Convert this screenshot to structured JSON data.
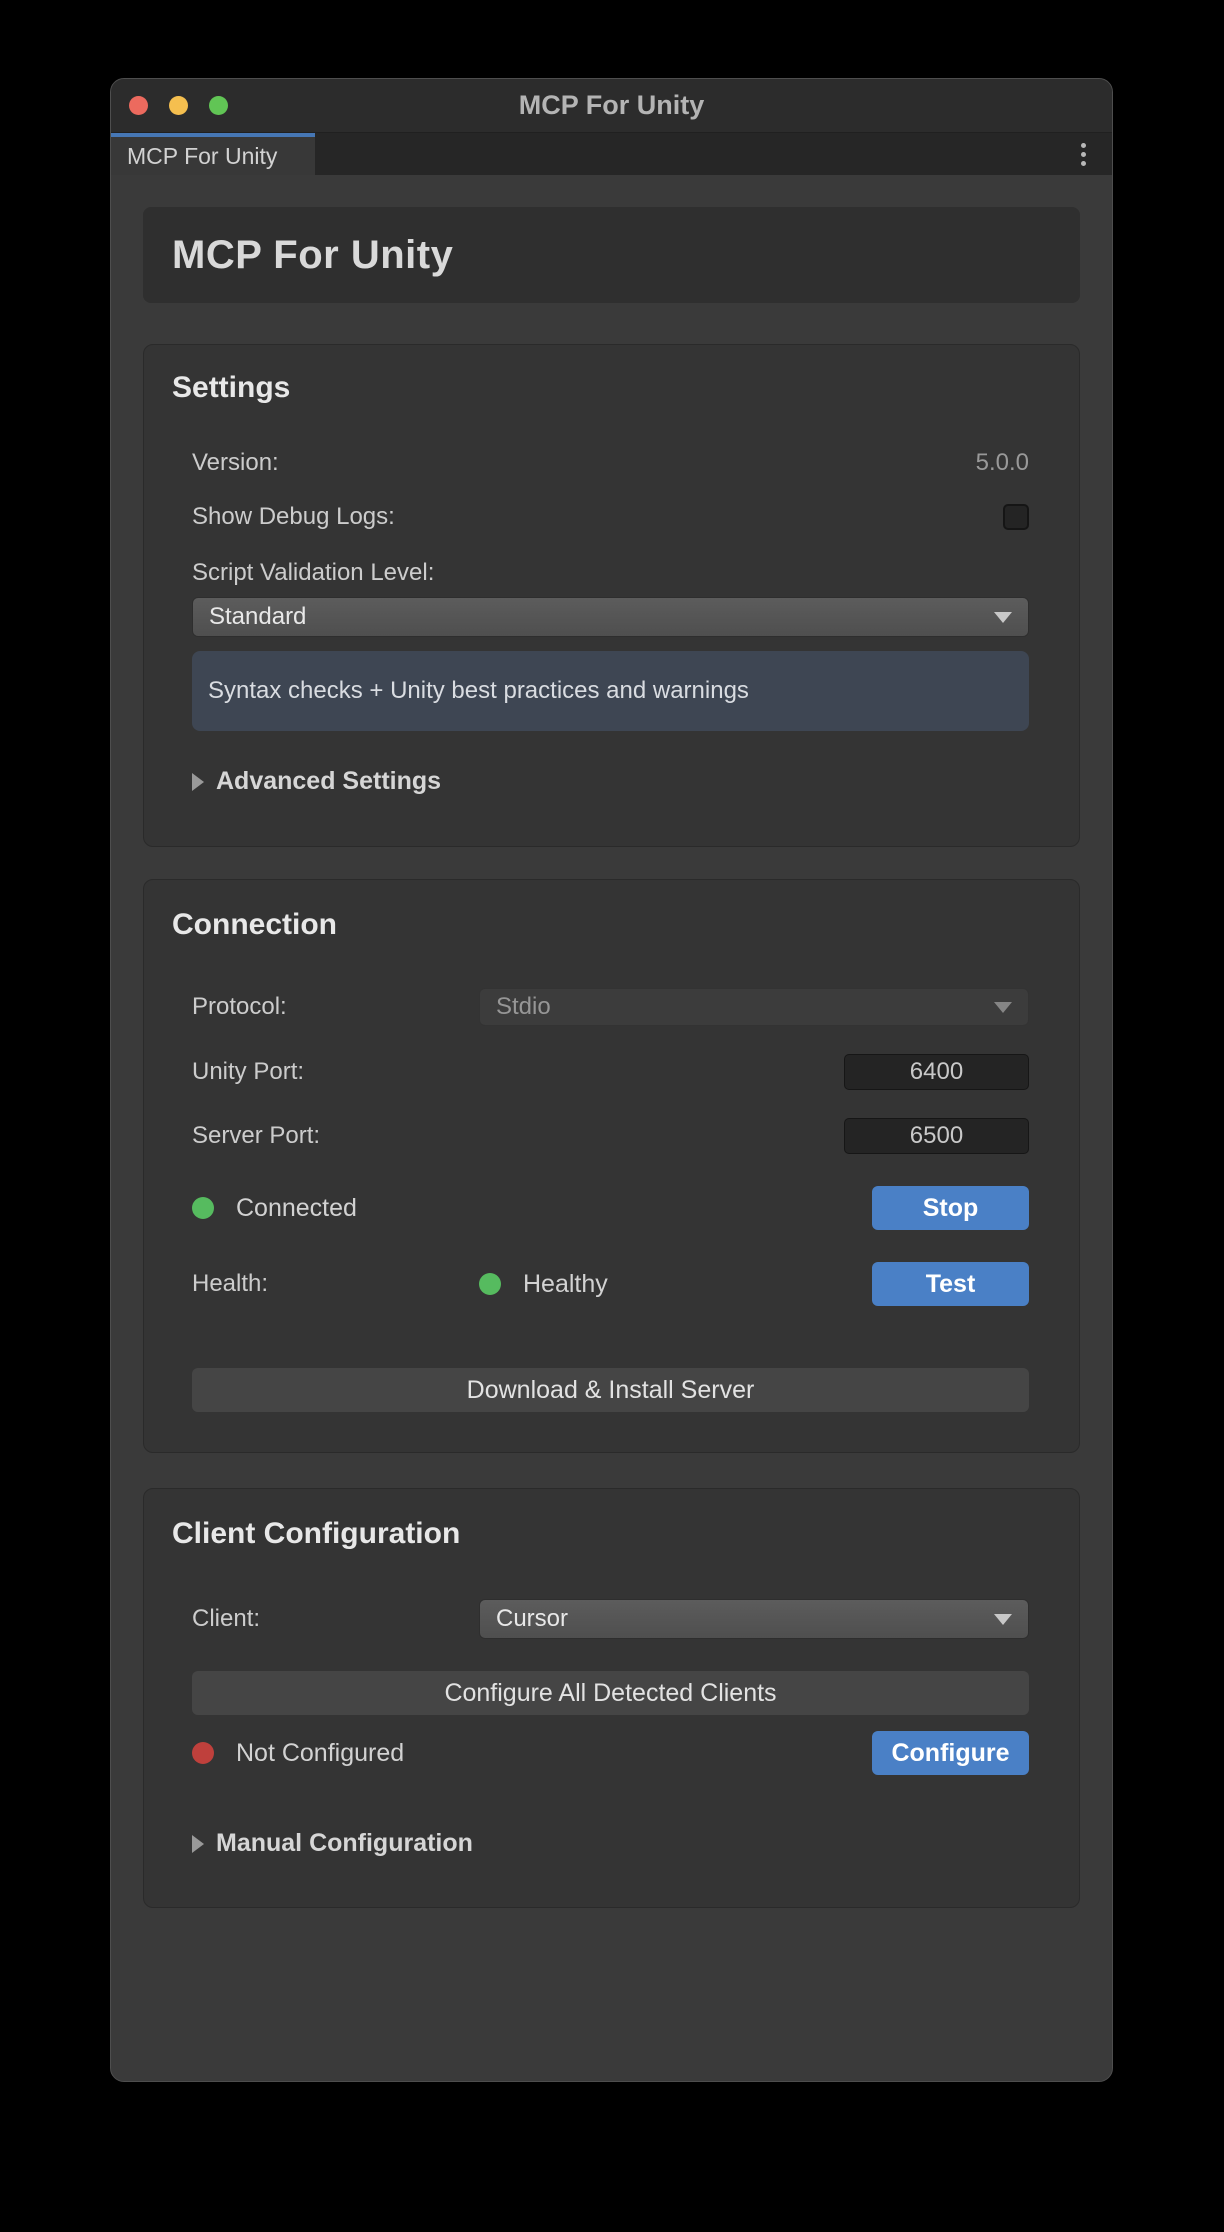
{
  "window": {
    "title": "MCP For Unity"
  },
  "tabbar": {
    "active_tab": "MCP For Unity"
  },
  "header": {
    "title": "MCP For Unity"
  },
  "settings": {
    "heading": "Settings",
    "version_label": "Version:",
    "version_value": "5.0.0",
    "debug_label": "Show Debug Logs:",
    "debug_checked": false,
    "validation_label": "Script Validation Level:",
    "validation_value": "Standard",
    "validation_help": "Syntax checks + Unity best practices and warnings",
    "advanced_foldout": "Advanced Settings"
  },
  "connection": {
    "heading": "Connection",
    "protocol_label": "Protocol:",
    "protocol_value": "Stdio",
    "unity_port_label": "Unity Port:",
    "unity_port_value": "6400",
    "server_port_label": "Server Port:",
    "server_port_value": "6500",
    "status_text": "Connected",
    "stop_button": "Stop",
    "health_label": "Health:",
    "health_status": "Healthy",
    "test_button": "Test",
    "download_button": "Download & Install Server"
  },
  "client_config": {
    "heading": "Client Configuration",
    "client_label": "Client:",
    "client_value": "Cursor",
    "configure_all_button": "Configure All Detected Clients",
    "status_text": "Not Configured",
    "configure_button": "Configure",
    "manual_foldout": "Manual Configuration"
  },
  "colors": {
    "accent_blue": "#4a80c6",
    "tab_accent": "#4677b5",
    "status_green": "#56bb5f",
    "status_red": "#bf403c"
  }
}
